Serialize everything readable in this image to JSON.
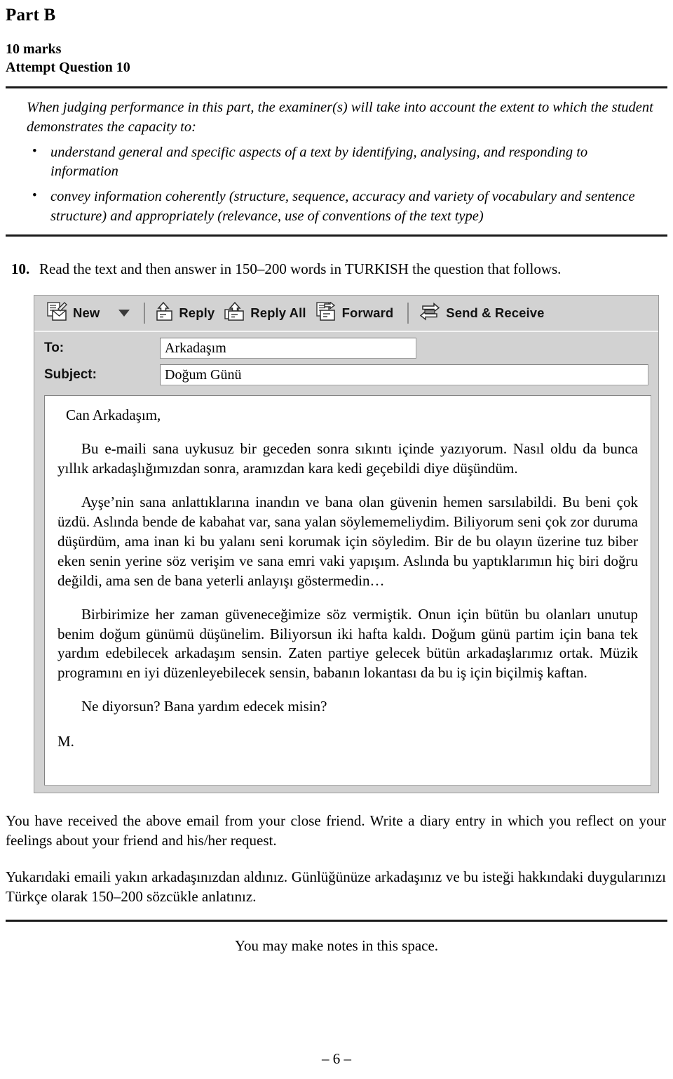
{
  "header": {
    "part_title": "Part B",
    "marks": "10 marks",
    "attempt": "Attempt Question 10"
  },
  "criteria": {
    "intro": "When judging performance in this part, the examiner(s) will take into account the extent to which the student demonstrates the capacity to:",
    "bullet_glyph": "•",
    "items": [
      "understand general and specific aspects of a text by identifying, analysing, and responding to information",
      "convey information coherently (structure, sequence, accuracy and variety of vocabulary and sentence structure) and appropriately (relevance, use of conventions of the text type)"
    ]
  },
  "question": {
    "number": "10.",
    "text": "Read the text and then answer in 150–200 words in TURKISH the question that follows."
  },
  "email": {
    "toolbar": {
      "new_label": "New",
      "reply_label": "Reply",
      "reply_all_label": "Reply All",
      "forward_label": "Forward",
      "send_receive_label": "Send & Receive"
    },
    "fields": {
      "to_label": "To:",
      "to_value": "Arkadaşım",
      "subject_label": "Subject:",
      "subject_value": "Doğum Günü"
    },
    "body": {
      "salutation": "Can Arkadaşım,",
      "paragraph_1": "Bu e-maili sana uykusuz bir geceden sonra sıkıntı içinde yazıyorum. Nasıl oldu da bunca yıllık arkadaşlığımızdan sonra, aramızdan kara kedi geçebildi diye düşündüm.",
      "paragraph_2": "Ayşe’nin sana anlattıklarına inandın ve bana olan güvenin hemen sarsılabildi. Bu beni çok üzdü. Aslında bende de kabahat var, sana yalan söylememeliydim. Biliyorum seni çok zor duruma düşürdüm, ama inan ki bu yalanı seni korumak için söyledim. Bir de bu olayın üzerine tuz biber eken senin yerine söz verişim ve sana emri vaki yapışım. Aslında bu yaptıklarımın hiç biri doğru değildi, ama sen de bana yeterli anlayışı göstermedin…",
      "paragraph_3": "Birbirimize her zaman güveneceğimize söz vermiştik. Onun için bütün bu olanları unutup benim doğum günümü düşünelim. Biliyorsun iki hafta kaldı. Doğum günü partim için bana tek yardım edebilecek arkadaşım sensin. Zaten partiye gelecek bütün arkadaşlarımız ortak. Müzik programını en iyi düzenleyebilecek sensin, babanın lokantası da bu iş için biçilmiş kaftan.",
      "paragraph_4": "Ne diyorsun? Bana yardım edecek misin?",
      "signature": "M."
    }
  },
  "instructions": {
    "english": "You have received the above email from your close friend. Write a diary entry in which you reflect on your feelings about your friend and his/her request.",
    "turkish": "Yukarıdaki emaili yakın arkadaşınızdan aldınız. Günlüğünüze arkadaşınız ve bu isteği hakkındaki duygularınızı Türkçe olarak 150–200 sözcükle anlatınız."
  },
  "notes": {
    "label": "You may make notes in this space."
  },
  "footer": {
    "page_number": "– 6 –"
  },
  "colors": {
    "toolbar_bg": "#d2d2d2",
    "panel_border": "#9a9a9a",
    "text": "#000000",
    "rule": "#1a1a1a"
  }
}
